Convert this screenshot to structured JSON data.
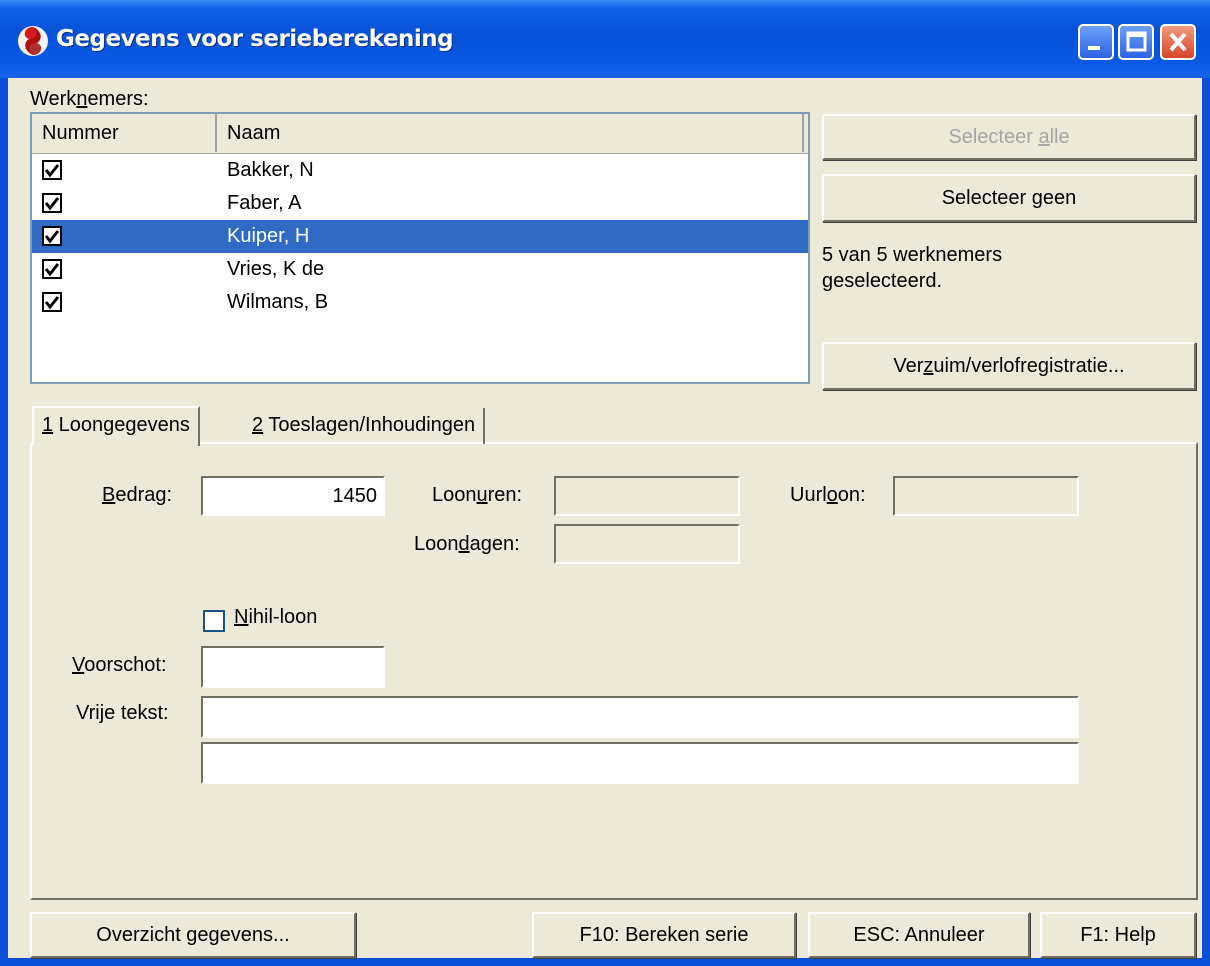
{
  "window": {
    "title": "Gegevens voor serieberekening"
  },
  "employees": {
    "label_pre": "Werk",
    "label_u": "n",
    "label_post": "emers:",
    "columns": [
      "Nummer",
      "Naam"
    ],
    "rows": [
      {
        "name": "Bakker, N",
        "checked": true
      },
      {
        "name": "Faber, A",
        "checked": true
      },
      {
        "name": "Kuiper, H",
        "checked": true,
        "selected": true
      },
      {
        "name": "Vries, K de",
        "checked": true
      },
      {
        "name": "Wilmans, B",
        "checked": true
      }
    ],
    "status_line1": "5 van 5 werknemers",
    "status_line2": "geselecteerd."
  },
  "buttons": {
    "select_all_pre": "Selecteer ",
    "select_all_u": "a",
    "select_all_post": "lle",
    "select_none_pre": "Selecteer ",
    "select_none_u": "g",
    "select_none_post": "een",
    "absence_pre": "Ver",
    "absence_u": "z",
    "absence_post": "uim/verlofregistratie...",
    "overview": "Overzicht gegevens...",
    "calculate": "F10: Bereken serie",
    "cancel": "ESC: Annuleer",
    "help": "F1: Help"
  },
  "tabs": [
    {
      "num": "1",
      "label": " Loongegevens"
    },
    {
      "num": "2",
      "label": " Toeslagen/Inhoudingen"
    }
  ],
  "form": {
    "amount_u": "B",
    "amount_post": "edrag:",
    "amount_value": "1450",
    "hours_pre": "Loon",
    "hours_u": "u",
    "hours_post": "ren:",
    "hourly_pre": "Uurl",
    "hourly_u": "o",
    "hourly_post": "on:",
    "days_pre": "Loon",
    "days_u": "d",
    "days_post": "agen:",
    "nil_u": "N",
    "nil_post": "ihil-loon",
    "advance_u": "V",
    "advance_post": "oorschot:",
    "free_text": "Vrije tekst:"
  }
}
